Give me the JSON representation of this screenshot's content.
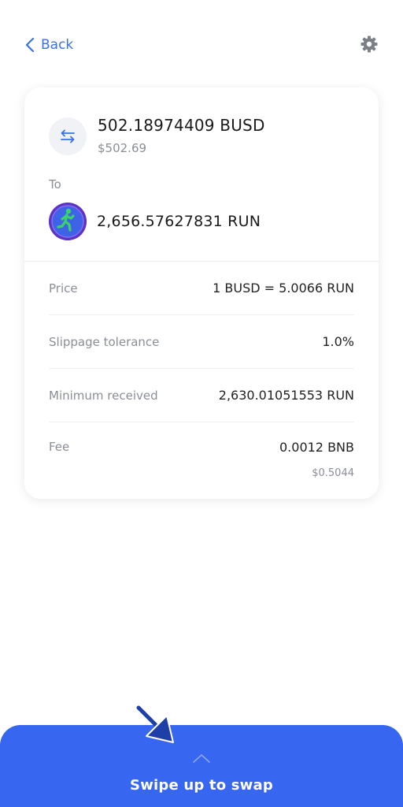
{
  "header": {
    "back_label": "Back",
    "settings_icon": "gear-icon"
  },
  "swap": {
    "from_amount": "502.18974409 BUSD",
    "from_usd": "$502.69",
    "to_label": "To",
    "to_amount": "2,656.57627831 RUN",
    "from_icon": "swap-arrows-icon",
    "to_icon": "run-token-logo"
  },
  "details": [
    {
      "label": "Price",
      "value": "1 BUSD = 5.0066 RUN"
    },
    {
      "label": "Slippage tolerance",
      "value": "1.0%"
    },
    {
      "label": "Minimum received",
      "value": "2,630.01051553 RUN"
    },
    {
      "label": "Fee",
      "value": "0.0012 BNB",
      "subvalue": "$0.5044"
    }
  ],
  "footer": {
    "swipe_label": "Swipe up to swap",
    "icon": "chevron-up-icon"
  },
  "colors": {
    "accent": "#3766f0",
    "link": "#3a6ff0",
    "muted_text": "#8a8e95",
    "card_bg": "#ffffff",
    "pointer": "#1f3fa8"
  }
}
